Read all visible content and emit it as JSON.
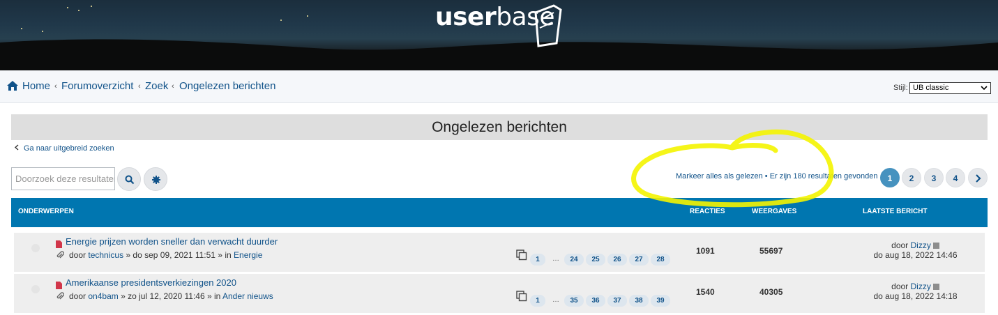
{
  "banner": {
    "logo_bold": "user",
    "logo_regular": "base"
  },
  "breadcrumbs": {
    "home": "Home",
    "forum": "Forumoverzicht",
    "search": "Zoek",
    "current": "Ongelezen berichten",
    "separator": "‹"
  },
  "style_switcher": {
    "label": "Stijl:",
    "selected": "UB classic"
  },
  "page_title": "Ongelezen berichten",
  "advanced_search_link": "Ga naar uitgebreid zoeken",
  "search": {
    "placeholder": "Doorzoek deze resultaten"
  },
  "action_bar": {
    "mark_read": "Markeer alles als gelezen",
    "bullet": "•",
    "results": "Er zijn 180 resultaten gevonden"
  },
  "pagination": [
    "1",
    "2",
    "3",
    "4"
  ],
  "table_header": {
    "topics": "ONDERWERPEN",
    "replies": "REACTIES",
    "views": "WEERGAVES",
    "last_post": "LAATSTE BERICHT"
  },
  "topics": [
    {
      "title": "Energie prijzen worden sneller dan verwacht duurder",
      "meta_prefix": "door",
      "author": "technicus",
      "meta_middle": "» do sep 09, 2021 11:51 » in",
      "forum": "Energie",
      "pages": [
        "1",
        "…",
        "24",
        "25",
        "26",
        "27",
        "28"
      ],
      "replies": "1091",
      "views": "55697",
      "last_by_prefix": "door",
      "last_author": "Dizzy",
      "last_date": "do aug 18, 2022 14:46"
    },
    {
      "title": "Amerikaanse presidentsverkiezingen 2020",
      "meta_prefix": "door",
      "author": "on4bam",
      "meta_middle": "» zo jul 12, 2020 11:46 » in",
      "forum": "Ander nieuws",
      "pages": [
        "1",
        "…",
        "35",
        "36",
        "37",
        "38",
        "39"
      ],
      "replies": "1540",
      "views": "40305",
      "last_by_prefix": "door",
      "last_author": "Dizzy",
      "last_date": "do aug 18, 2022 14:18"
    }
  ],
  "colors": {
    "link": "#105289",
    "header_bar": "#0076b0",
    "active_page": "#4692bf",
    "annotation_highlight": "#f4f400"
  }
}
